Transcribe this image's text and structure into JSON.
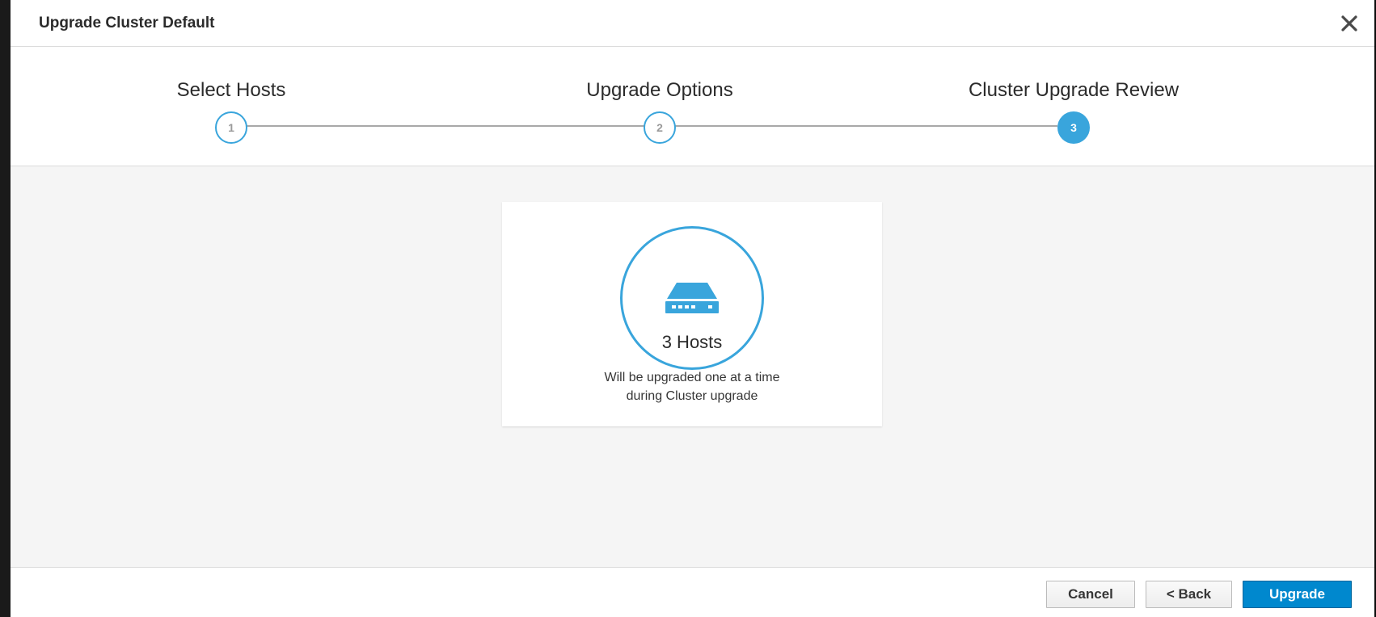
{
  "modal": {
    "title": "Upgrade Cluster Default",
    "close_icon": "close-icon"
  },
  "wizard": {
    "steps": [
      {
        "label": "Select Hosts",
        "number": "1",
        "active": false
      },
      {
        "label": "Upgrade Options",
        "number": "2",
        "active": false
      },
      {
        "label": "Cluster Upgrade Review",
        "number": "3",
        "active": true
      }
    ]
  },
  "review": {
    "icon": "server-icon",
    "count_text": "3 Hosts",
    "description_line1": "Will be upgraded one at a time",
    "description_line2": "during Cluster upgrade"
  },
  "footer": {
    "cancel_label": "Cancel",
    "back_label": "< Back",
    "upgrade_label": "Upgrade"
  },
  "colors": {
    "accent": "#39a5dc",
    "primary_button": "#0088ce",
    "body_background": "#f5f5f5"
  }
}
